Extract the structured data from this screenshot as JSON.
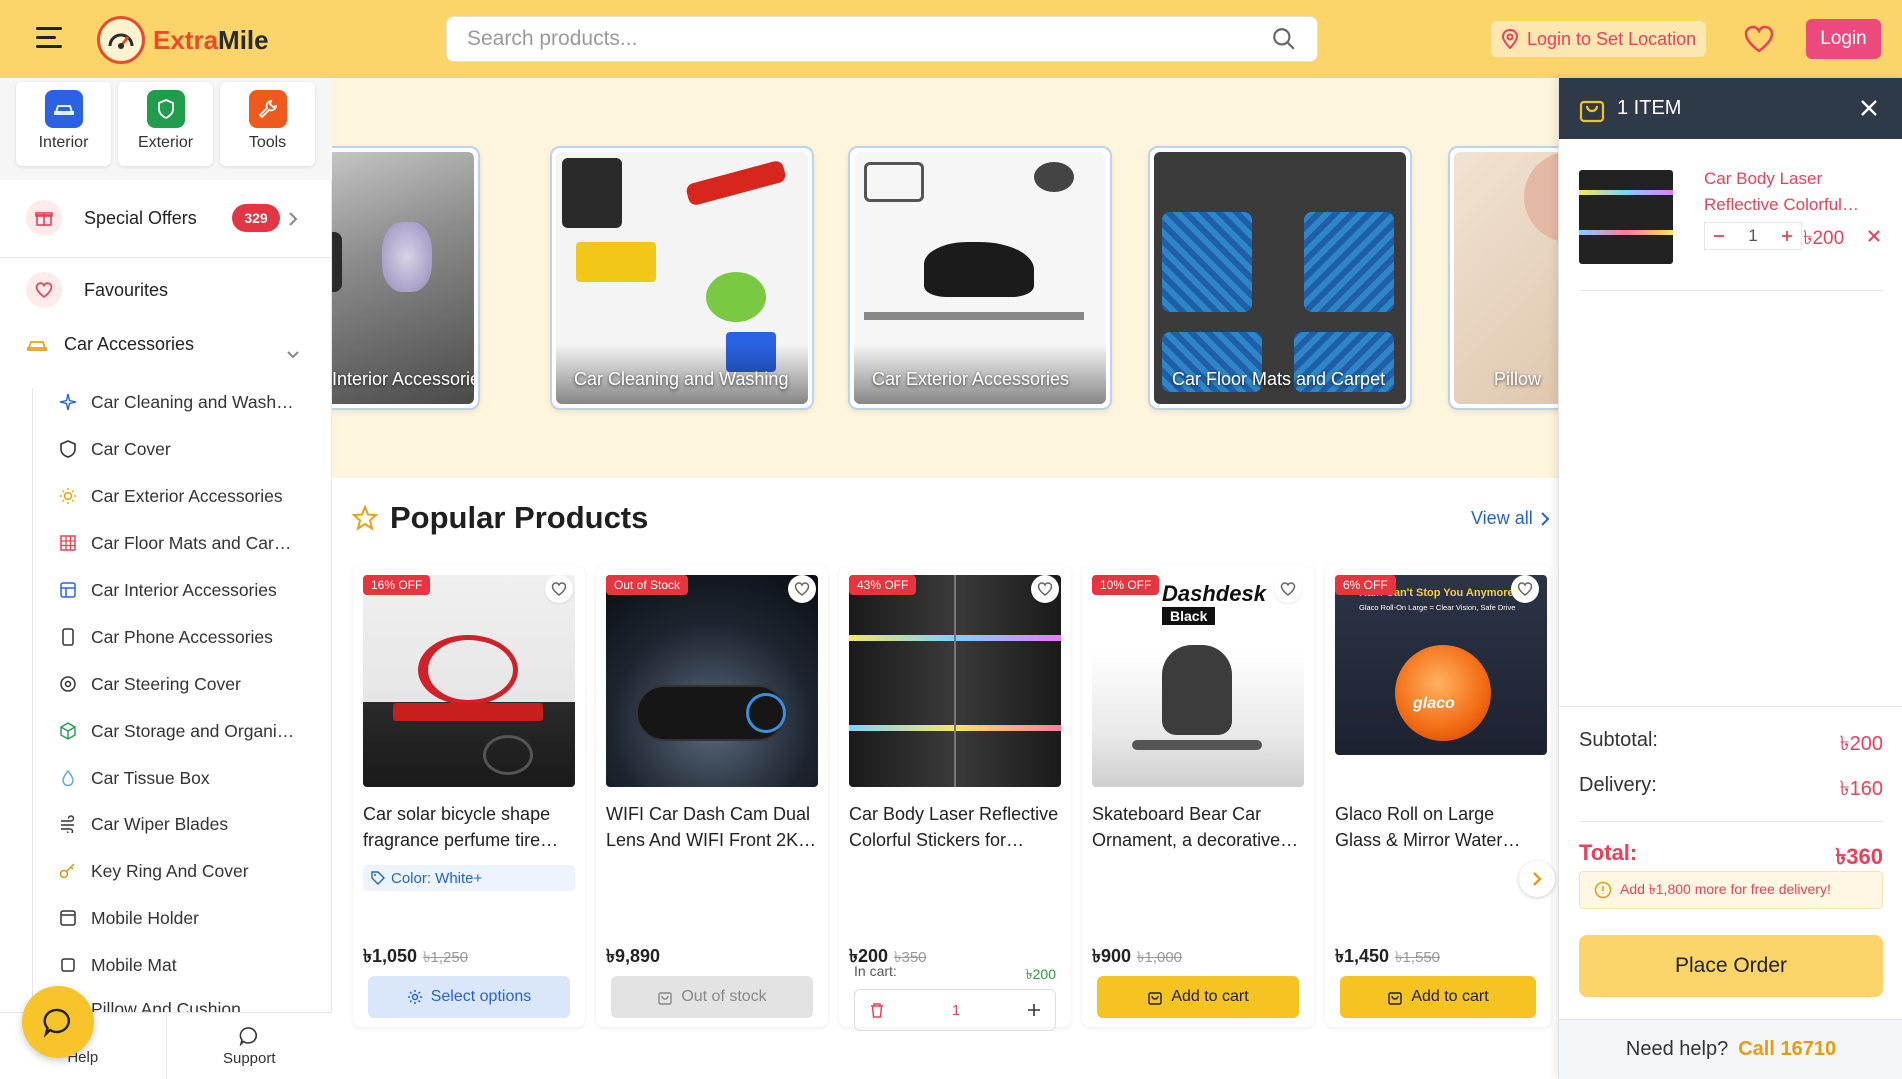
{
  "header": {
    "brand_part1": "Extra",
    "brand_part2": "Mile",
    "search_placeholder": "Search products...",
    "location_label": "Login to Set Location",
    "login_label": "Login"
  },
  "sidebar": {
    "quick_links": [
      {
        "label": "Interior",
        "color": "#2b62e3"
      },
      {
        "label": "Exterior",
        "color": "#1f9d4c"
      },
      {
        "label": "Tools",
        "color": "#ef5a1c"
      }
    ],
    "special_offers": {
      "label": "Special Offers",
      "count": "329"
    },
    "favourites_label": "Favourites",
    "car_accessories_label": "Car Accessories",
    "subcategories": [
      {
        "label": "Car Cleaning and Wash…",
        "icon": "sparkle-icon"
      },
      {
        "label": "Car Cover",
        "icon": "shield-icon"
      },
      {
        "label": "Car Exterior Accessories",
        "icon": "sun-icon"
      },
      {
        "label": "Car Floor Mats and Car…",
        "icon": "grid-icon"
      },
      {
        "label": "Car Interior Accessories",
        "icon": "layout-icon"
      },
      {
        "label": "Car Phone Accessories",
        "icon": "phone-icon"
      },
      {
        "label": "Car Steering Cover",
        "icon": "steering-icon"
      },
      {
        "label": "Car Storage and Organi…",
        "icon": "box-icon"
      },
      {
        "label": "Car Tissue Box",
        "icon": "drop-icon"
      },
      {
        "label": "Car Wiper Blades",
        "icon": "wind-icon"
      },
      {
        "label": "Key Ring And Cover",
        "icon": "key-icon"
      },
      {
        "label": "Mobile Holder",
        "icon": "holder-icon"
      },
      {
        "label": "Mobile Mat",
        "icon": "square-icon"
      },
      {
        "label": "Pillow And Cushion",
        "icon": "pillow-icon"
      }
    ],
    "bottom_tabs": {
      "help": "Help",
      "support": "Support"
    }
  },
  "categories": [
    {
      "label": "Interior Accessories"
    },
    {
      "label": "Car Cleaning and Washing"
    },
    {
      "label": "Car Exterior Accessories"
    },
    {
      "label": "Car Floor Mats and Carpet"
    },
    {
      "label": "Pillow"
    }
  ],
  "popular": {
    "title": "Popular Products",
    "view_all": "View all",
    "products": [
      {
        "badge": "16% OFF",
        "name": "Car solar bicycle shape fragrance perfume tire…",
        "color_tag": "Color: White+",
        "price": "৳1,050",
        "old_price": "৳1,250",
        "action": "Select options"
      },
      {
        "badge": "Out of Stock",
        "name": "WIFI Car Dash Cam Dual Lens And WIFI Front 2K…",
        "price": "৳9,890",
        "old_price": "",
        "action": "Out of stock"
      },
      {
        "badge": "43% OFF",
        "name": "Car Body Laser Reflective Colorful Stickers for…",
        "price": "৳200",
        "old_price": "৳350",
        "in_cart_label": "In cart:",
        "in_cart_value": "৳200",
        "qty": "1"
      },
      {
        "badge": "10% OFF",
        "name": "Skateboard Bear Car Ornament, a decorative…",
        "price": "৳900",
        "old_price": "৳1,000",
        "action": "Add to cart",
        "img_text_1": "Dashdesk",
        "img_text_2": "Black"
      },
      {
        "badge": "6% OFF",
        "name": "Glaco Roll on Large Glass & Mirror Water repellent…",
        "price": "৳1,450",
        "old_price": "৳1,550",
        "action": "Add to cart",
        "img_text_1": "Rain Can't Stop You Anymore",
        "img_text_2": "Glaco Roll-On Large = Clear Vision, Safe Drive",
        "img_text_3": "glaco"
      }
    ]
  },
  "cart": {
    "title": "1 ITEM",
    "item": {
      "name": "Car Body Laser Reflective Colorful…",
      "qty": "1",
      "price": "৳200"
    },
    "subtotal_label": "Subtotal:",
    "subtotal": "৳200",
    "delivery_label": "Delivery:",
    "delivery": "৳160",
    "total_label": "Total:",
    "total": "৳360",
    "free_delivery_note": "Add ৳1,800 more for free delivery!",
    "place_order": "Place Order",
    "help_text": "Need help?",
    "call_text": "Call 16710"
  },
  "colors": {
    "header_bg": "#fbd56a",
    "accent_red": "#e8415a",
    "login_pink": "#ec4a7c",
    "add_to_cart_yellow": "#f5c322",
    "link_blue": "#2563c9"
  }
}
